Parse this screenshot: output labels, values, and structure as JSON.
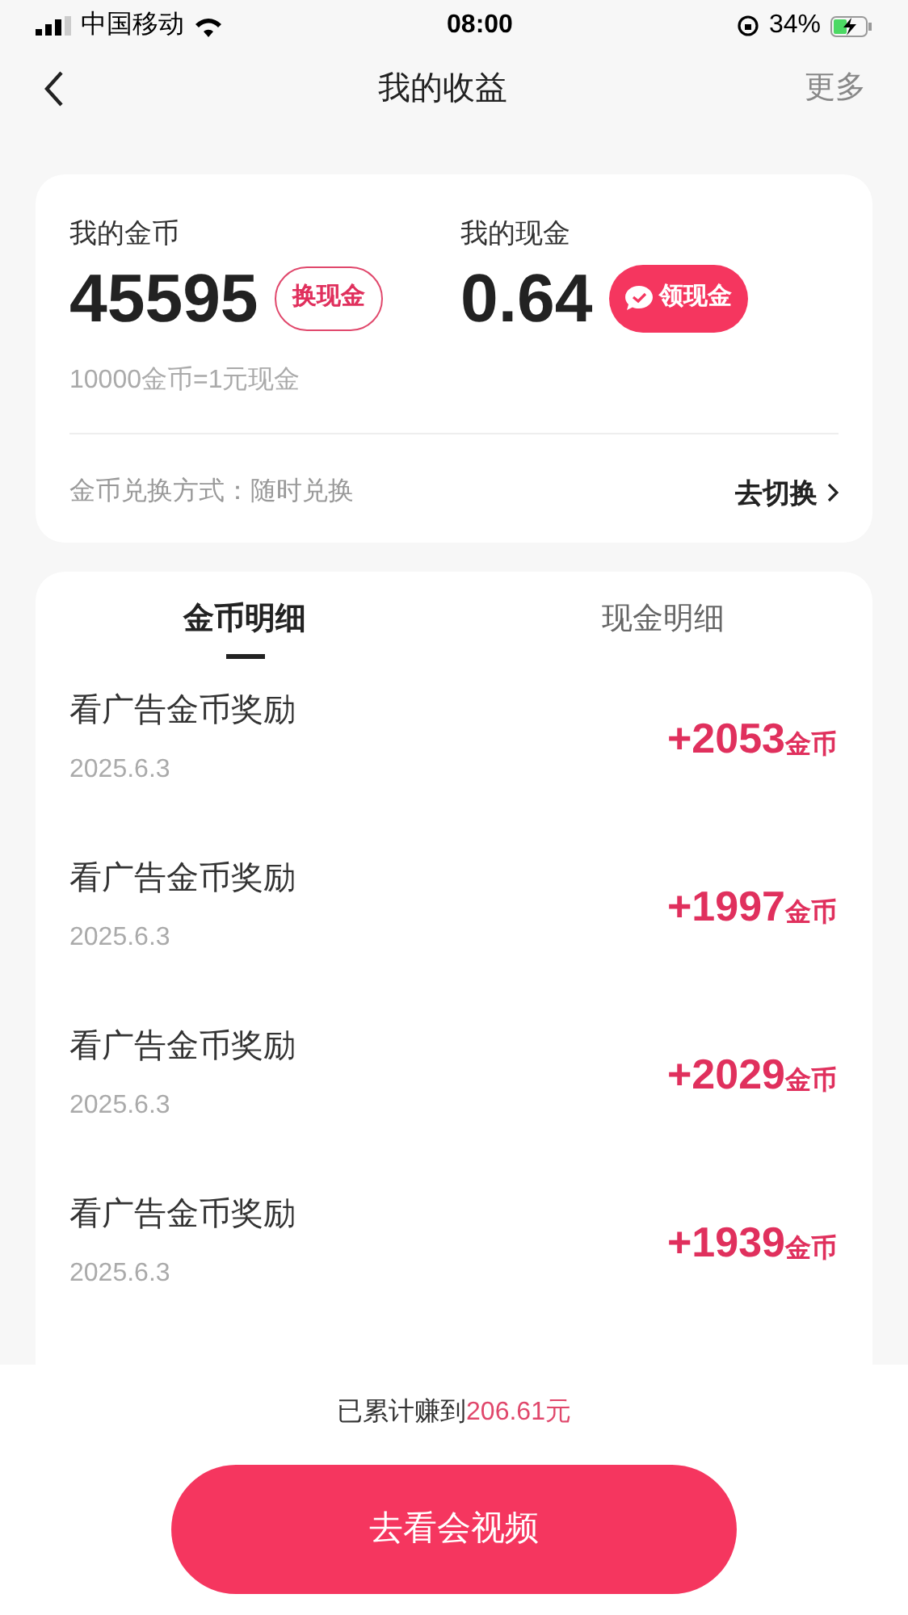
{
  "status_bar": {
    "carrier": "中国移动",
    "time": "08:00",
    "battery": "34%"
  },
  "nav": {
    "title": "我的收益",
    "more": "更多"
  },
  "balance": {
    "coins_label": "我的金币",
    "coins": "45595",
    "exchange_button": "换现金",
    "cash_label": "我的现金",
    "cash": "0.64",
    "withdraw_button": "领现金",
    "rate": "10000金币=1元现金",
    "method": "金币兑换方式：随时兑换",
    "switch_link": "去切换"
  },
  "tabs": [
    {
      "label": "金币明细",
      "selected": true
    },
    {
      "label": "现金明细",
      "selected": false
    }
  ],
  "records": [
    {
      "title": "看广告金币奖励",
      "date": "2025.6.3",
      "amount": "+2053",
      "unit": "金币"
    },
    {
      "title": "看广告金币奖励",
      "date": "2025.6.3",
      "amount": "+1997",
      "unit": "金币"
    },
    {
      "title": "看广告金币奖励",
      "date": "2025.6.3",
      "amount": "+2029",
      "unit": "金币"
    },
    {
      "title": "看广告金币奖励",
      "date": "2025.6.3",
      "amount": "+1939",
      "unit": "金币"
    }
  ],
  "footer": {
    "total_label": "已累计赚到",
    "total_value": "206.61元",
    "button": "去看会视频"
  }
}
